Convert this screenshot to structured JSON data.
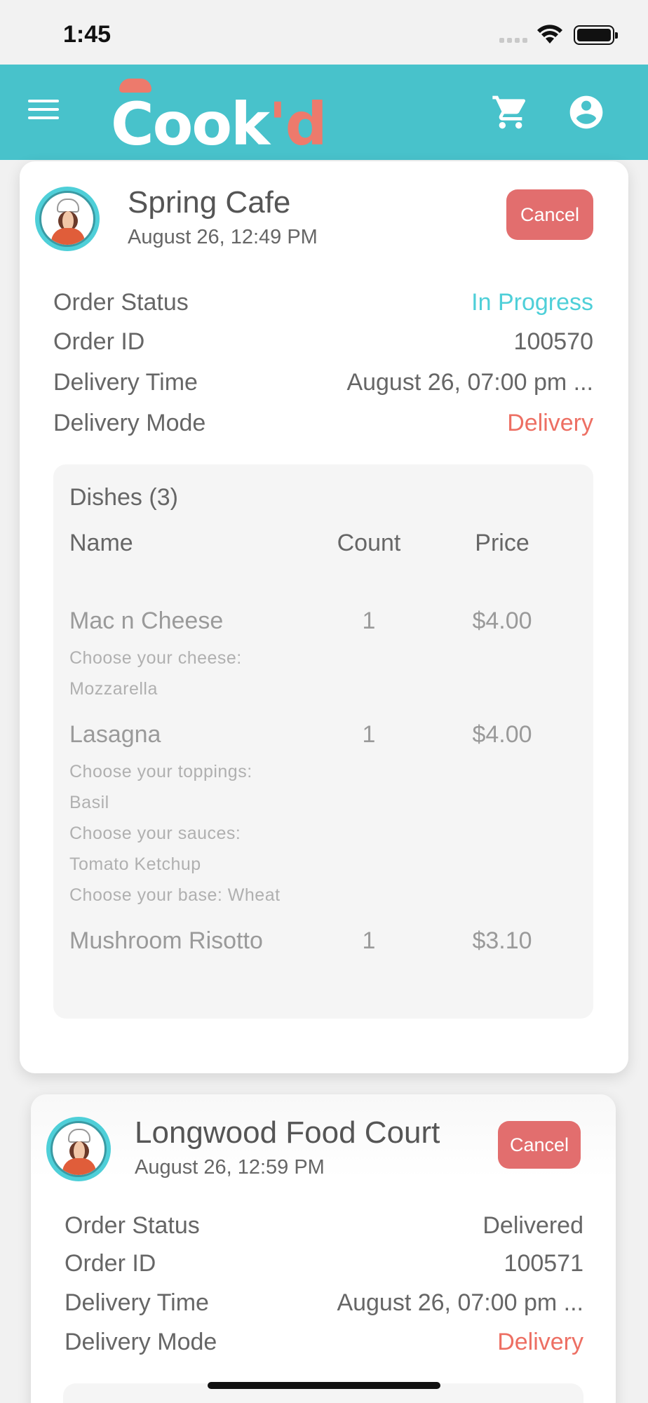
{
  "status_bar": {
    "time": "1:45"
  },
  "header": {
    "logo_text_main": "Cook",
    "logo_text_accent": "'d",
    "brand_color": "#48c2cb",
    "accent_color": "#ed7a6c"
  },
  "orders": [
    {
      "shop_name": "Spring Cafe",
      "date": "August 26, 12:49 PM",
      "cancel_label": "Cancel",
      "labels": {
        "status": "Order Status",
        "id": "Order ID",
        "delivery_time": "Delivery Time",
        "delivery_mode": "Delivery Mode"
      },
      "status": "In Progress",
      "id": "100570",
      "delivery_time": "August 26, 07:00 pm ...",
      "delivery_mode": "Delivery",
      "dishes_title": "Dishes (3)",
      "columns": {
        "name": "Name",
        "count": "Count",
        "price": "Price"
      },
      "dishes": [
        {
          "name": "Mac n Cheese",
          "count": "1",
          "price": "$4.00",
          "options": [
            "Choose your cheese:",
            "Mozzarella"
          ]
        },
        {
          "name": "Lasagna",
          "count": "1",
          "price": "$4.00",
          "options": [
            "Choose your toppings:",
            "Basil",
            "Choose your sauces:",
            "Tomato Ketchup",
            "Choose your base: Wheat"
          ]
        },
        {
          "name": "Mushroom Risotto",
          "count": "1",
          "price": "$3.10",
          "options": []
        }
      ]
    },
    {
      "shop_name": "Longwood Food Court",
      "date": "August 26, 12:59 PM",
      "cancel_label": "Cancel",
      "labels": {
        "status": "Order Status",
        "id": "Order ID",
        "delivery_time": "Delivery Time",
        "delivery_mode": "Delivery Mode"
      },
      "status": "Delivered",
      "id": "100571",
      "delivery_time": "August 26, 07:00 pm ...",
      "delivery_mode": "Delivery"
    }
  ],
  "icons": {
    "menu": "menu-icon",
    "cart": "cart-icon",
    "account": "account-icon",
    "wifi": "wifi-icon",
    "battery": "battery-icon"
  }
}
